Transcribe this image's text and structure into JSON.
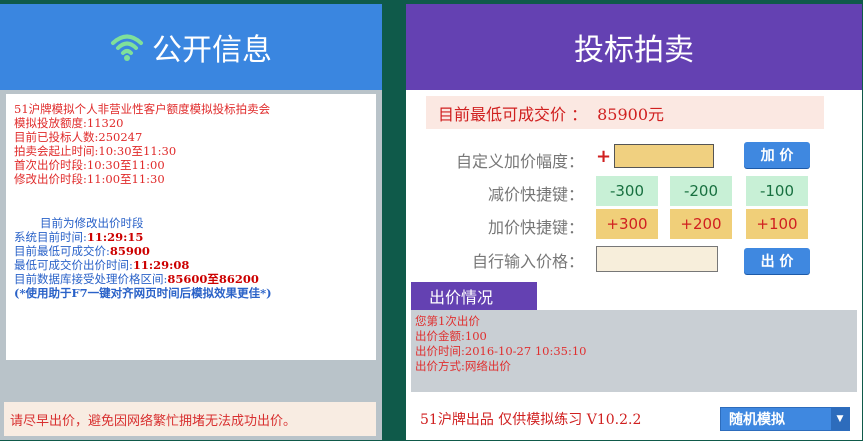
{
  "left": {
    "title": "公开信息",
    "lines": [
      "51沪牌模拟个人非营业性客户额度模拟投标拍卖会",
      "模拟投放额度:11320",
      "目前已投标人数:250247",
      "拍卖会起止时间:10:30至11:30",
      "首次出价时段:10:30至11:00",
      "修改出价时段:11:00至11:30",
      "目前为修改出价时段",
      "系统目前时间:",
      "11:29:15",
      "目前最低可成交价:",
      "85900",
      "最低可成交价出价时间:",
      "11:29:08",
      "目前数据库接受处理价格区间:",
      "85600至86200",
      "(*使用助于F7一键对齐网页时间后模拟效果更佳*)"
    ],
    "footer": "请尽早出价，避免因网络繁忙拥堵无法成功出价。"
  },
  "right": {
    "title": "投标拍卖",
    "min_price_label": "目前最低可成交价 ：",
    "min_price_value": "85900元",
    "custom_increase_label": "自定义加价幅度：",
    "plus_sign": "+",
    "add_price_button": "加 价",
    "decrease_label": "减价快捷键：",
    "decrease_values": [
      "-300",
      "-200",
      "-100"
    ],
    "increase_label": "加价快捷键：",
    "increase_values": [
      "+300",
      "+200",
      "+100"
    ],
    "self_input_label": "自行输入价格：",
    "bid_button": "出 价",
    "bid_status_tab": "出价情况",
    "bid_status_lines": [
      "您第1次出价",
      "出价金额:100",
      "出价时间:2016-10-27 10:35:10",
      "出价方式:网络出价"
    ],
    "footer_text": "51沪牌出品 仅供模拟练习 V10.2.2",
    "mode_select": "随机模拟"
  },
  "colors": {
    "left_header": "#3a86e0",
    "right_header": "#6441b2",
    "accent_red": "#d02020",
    "background": "#0f5a4a"
  },
  "icons": {
    "header_left_icon": "wifi-icon",
    "mode_select_icon": "chevron-down-icon"
  }
}
